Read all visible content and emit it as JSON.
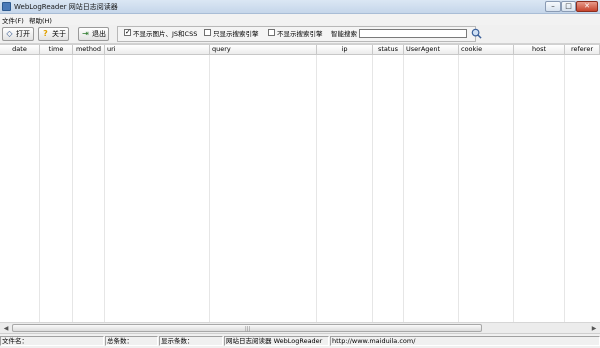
{
  "window": {
    "title": "WebLogReader 网站日志阅读器",
    "minimize_glyph": "–",
    "maximize_glyph": "□",
    "close_glyph": "✕"
  },
  "menu": {
    "file": "文件(F)",
    "help": "帮助(H)"
  },
  "toolbar": {
    "open_label": "打开",
    "about_label": "关于",
    "exit_label": "退出",
    "icons": [
      "open-icon",
      "help-icon",
      "exit-icon"
    ]
  },
  "filters": {
    "hide_images": {
      "label": "不显示图片、JS和CSS",
      "checked": true
    },
    "only_search_engines": {
      "label": "只显示搜索引擎",
      "checked": false
    },
    "hide_search_engines": {
      "label": "不显示搜索引擎",
      "checked": false
    },
    "smart_search_label": "智能搜索",
    "smart_search_value": ""
  },
  "table": {
    "columns": [
      "date",
      "time",
      "method",
      "uri",
      "query",
      "ip",
      "status",
      "UserAgent",
      "cookie",
      "host",
      "referer"
    ],
    "rows": []
  },
  "statusbar": {
    "file_name": "文件名：",
    "total": "总条数：",
    "shown": "显示条数：",
    "app": "网站日志阅读器  WebLogReader",
    "url": "http://www.maiduila.com/"
  },
  "colors": {
    "title_bar": "#c5d6ea",
    "close_button": "#c6442d"
  }
}
